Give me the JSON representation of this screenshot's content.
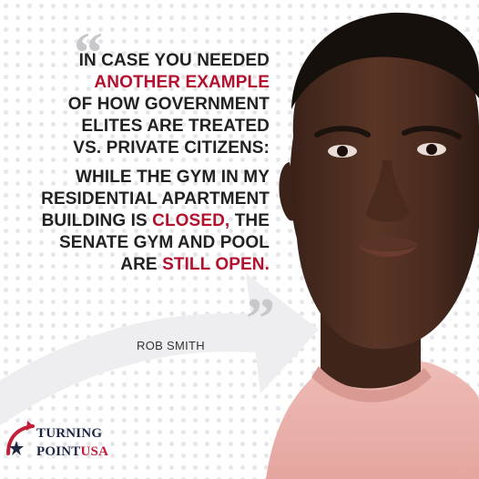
{
  "quote": {
    "lines": [
      [
        {
          "text": "In case you needed",
          "emph": false
        }
      ],
      [
        {
          "text": "another example",
          "emph": true
        }
      ],
      [
        {
          "text": "of how government",
          "emph": false
        }
      ],
      [
        {
          "text": "elites are treated",
          "emph": false
        }
      ],
      [
        {
          "text": "vs. private citizens:",
          "emph": false
        }
      ],
      [
        {
          "text": "while the gym in my",
          "emph": false
        }
      ],
      [
        {
          "text": "residential apartment",
          "emph": false
        }
      ],
      [
        {
          "text": "building is ",
          "emph": false
        },
        {
          "text": "closed,",
          "emph": true
        },
        {
          "text": " the",
          "emph": false
        }
      ],
      [
        {
          "text": "senate gym and pool",
          "emph": false
        }
      ],
      [
        {
          "text": "are ",
          "emph": false
        },
        {
          "text": "still open.",
          "emph": true
        }
      ]
    ],
    "open_mark": "“",
    "close_mark": "”"
  },
  "author": "ROB SMITH",
  "logo": {
    "line1": "TURNING",
    "line2_main": "POINT",
    "line2_accent": "USA",
    "mark_icon": "star-swoosh-icon"
  },
  "colors": {
    "accent_red": "#b3112e",
    "text_dark": "#222222",
    "brand_navy": "#1d2743",
    "quote_mark_gray": "#c7c7cc",
    "shirt_pink": "#eab3ae"
  }
}
